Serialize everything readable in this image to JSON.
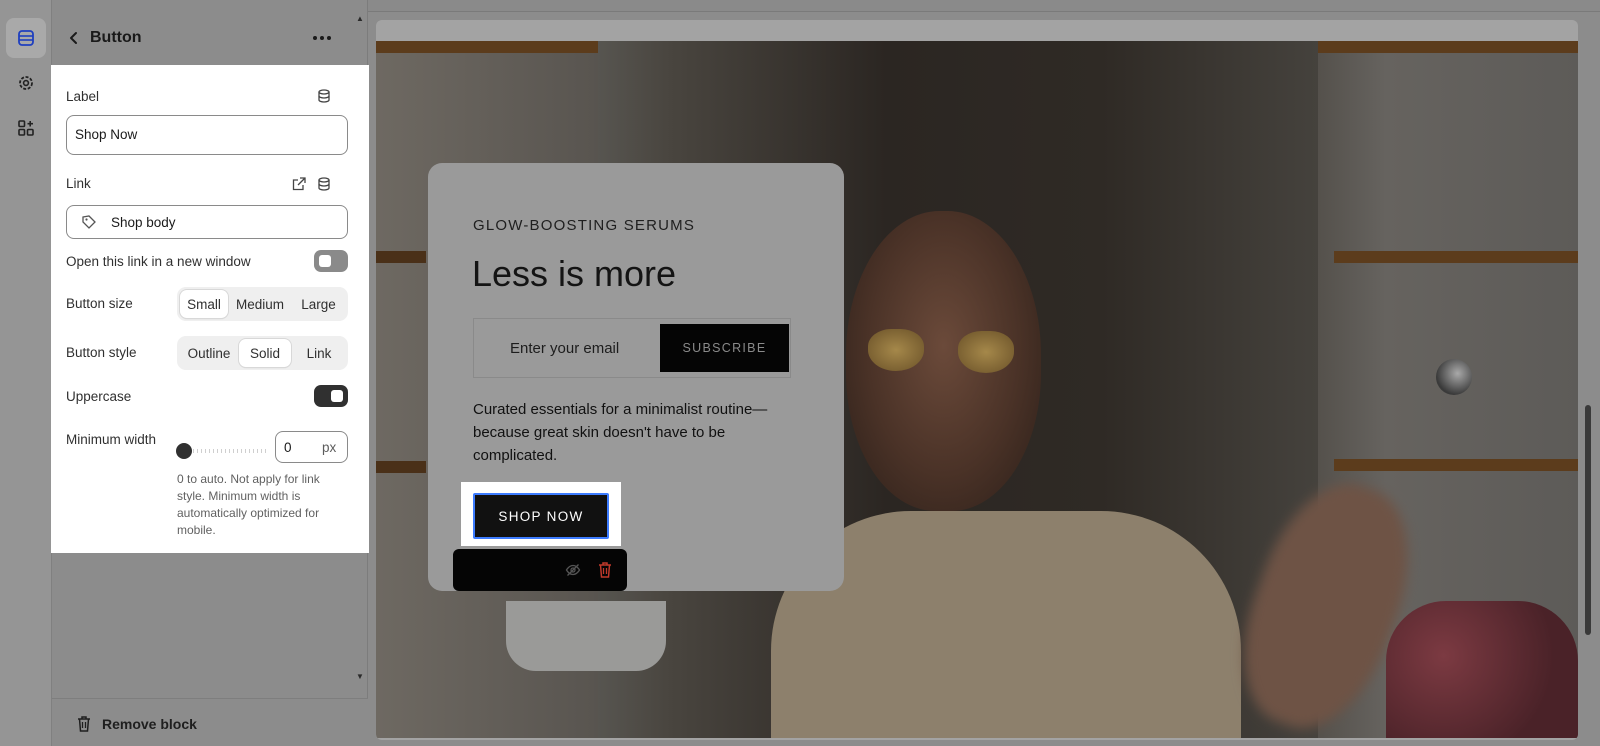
{
  "panel": {
    "title": "Button",
    "label_field": {
      "label": "Label",
      "value": "Shop Now"
    },
    "link_field": {
      "label": "Link",
      "value": "Shop body"
    },
    "new_window": {
      "label": "Open this link in a new window",
      "enabled": false
    },
    "button_size": {
      "label": "Button size",
      "options": [
        "Small",
        "Medium",
        "Large"
      ],
      "selected": "Small"
    },
    "button_style": {
      "label": "Button style",
      "options": [
        "Outline",
        "Solid",
        "Link"
      ],
      "selected": "Solid"
    },
    "uppercase": {
      "label": "Uppercase",
      "enabled": true
    },
    "min_width": {
      "label": "Minimum width",
      "value": "0",
      "unit": "px",
      "help": "0 to auto. Not apply for link style. Minimum width is automatically optimized for mobile."
    },
    "remove_label": "Remove block"
  },
  "preview": {
    "subhead": "GLOW-BOOSTING SERUMS",
    "headline": "Less is more",
    "email_placeholder": "Enter your email",
    "subscribe_label": "SUBSCRIBE",
    "description": "Curated essentials for a minimalist routine—because great skin doesn't have to be complicated.",
    "cta_label": "SHOP NOW"
  },
  "colors": {
    "selection_outline": "#3d7cff",
    "delete_red": "#c0392b",
    "band_gold": "#5c3c1c"
  },
  "icons": {
    "rail": [
      "sections-icon",
      "settings-gear-icon",
      "apps-icon"
    ],
    "toolbar": [
      "eye-off-icon",
      "trash-icon"
    ]
  }
}
